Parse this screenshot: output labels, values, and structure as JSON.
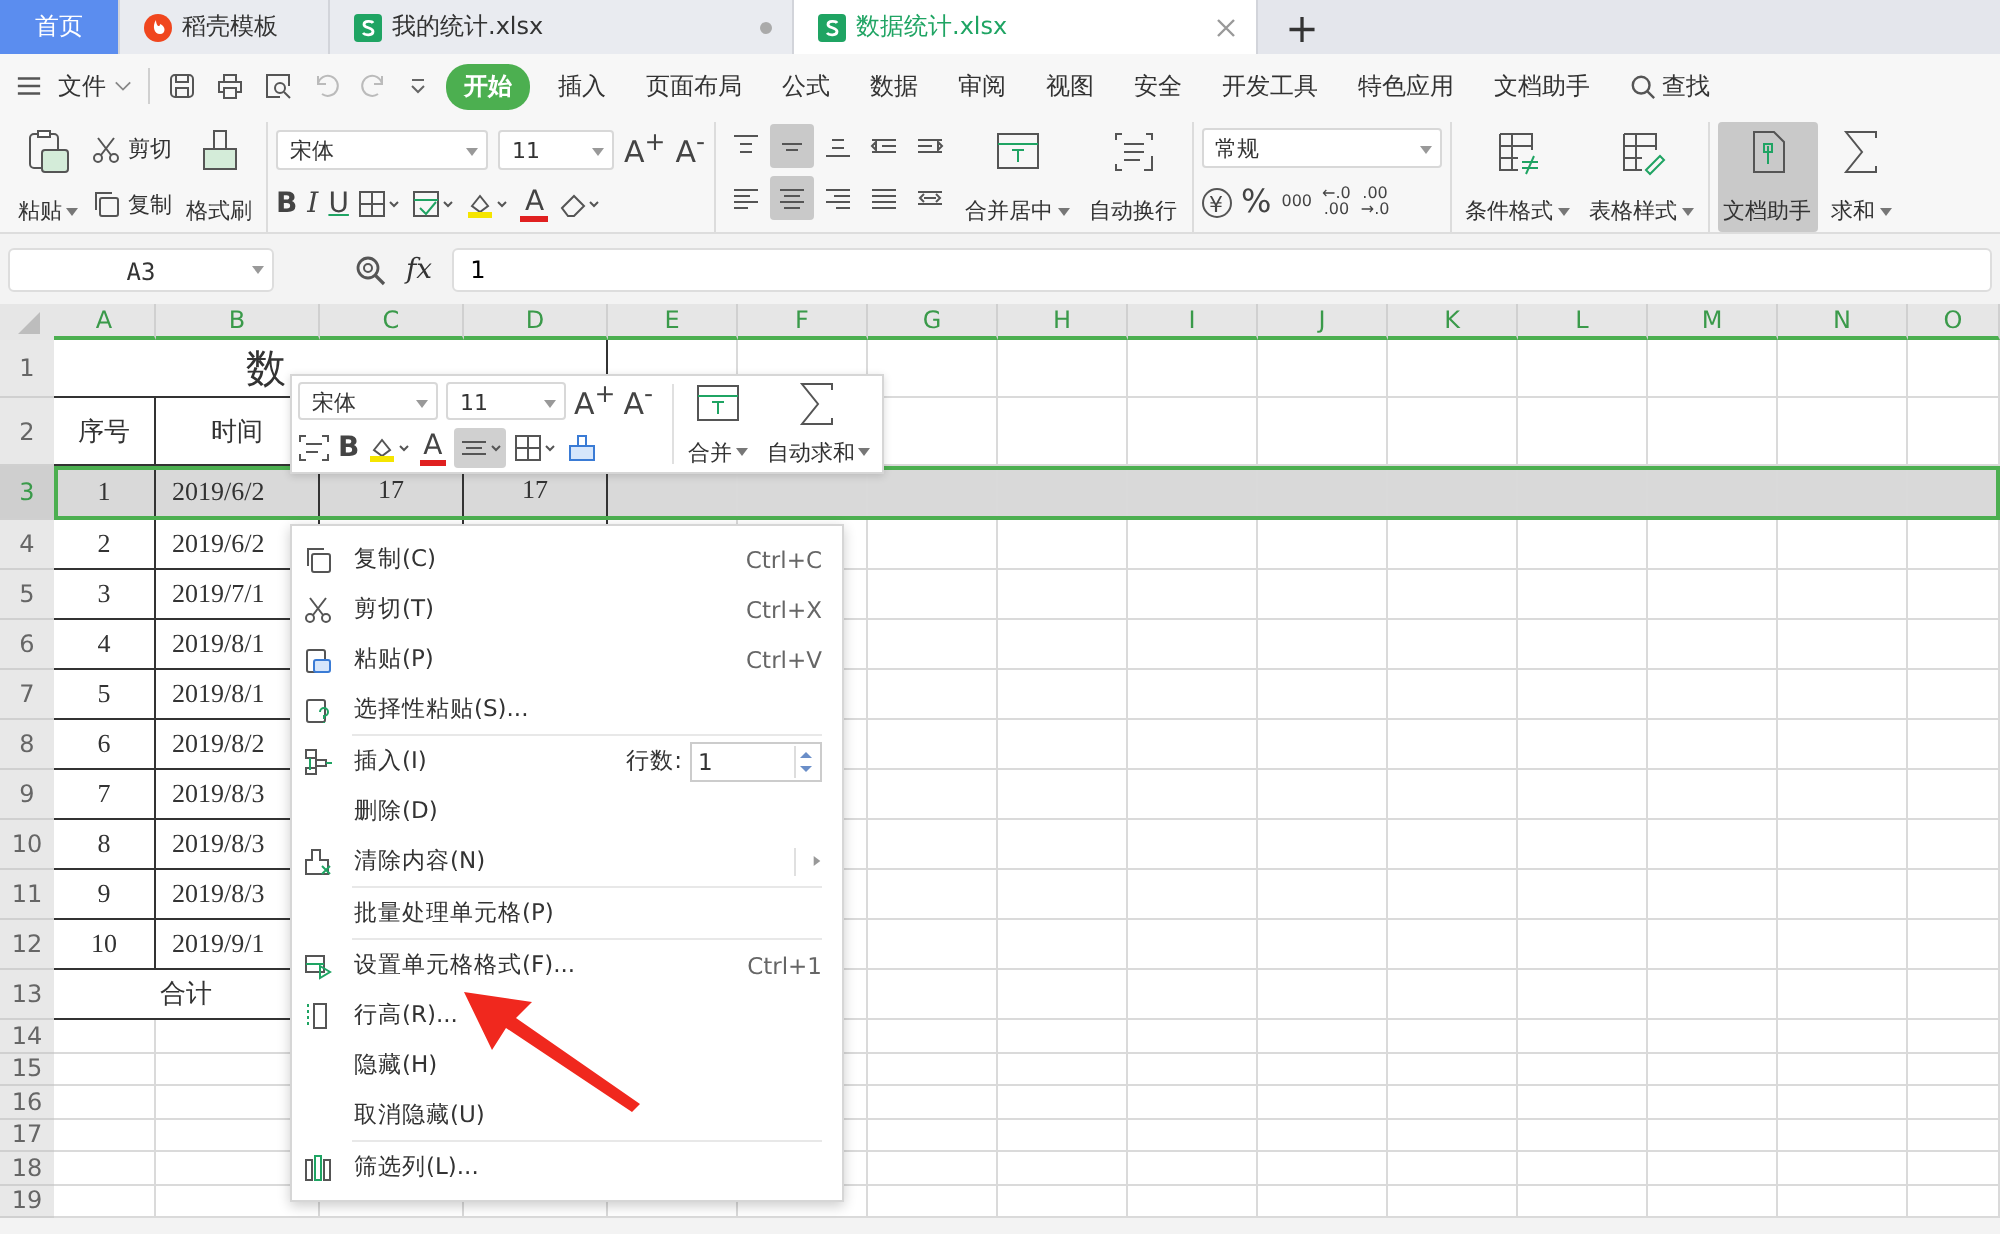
{
  "tabs": [
    {
      "label": "首页",
      "kind": "home",
      "selected": false,
      "modified": false
    },
    {
      "label": "稻壳模板",
      "kind": "docer",
      "selected": false,
      "modified": false
    },
    {
      "label": "我的统计.xlsx",
      "kind": "sheet",
      "selected": false,
      "modified": true
    },
    {
      "label": "数据统计.xlsx",
      "kind": "sheet",
      "selected": true,
      "modified": false
    }
  ],
  "new_tab": "+",
  "menu": {
    "file": "文件",
    "items": [
      {
        "label": "开始",
        "selected": true
      },
      {
        "label": "插入",
        "selected": false
      },
      {
        "label": "页面布局",
        "selected": false
      },
      {
        "label": "公式",
        "selected": false
      },
      {
        "label": "数据",
        "selected": false
      },
      {
        "label": "审阅",
        "selected": false
      },
      {
        "label": "视图",
        "selected": false
      },
      {
        "label": "安全",
        "selected": false
      },
      {
        "label": "开发工具",
        "selected": false
      },
      {
        "label": "特色应用",
        "selected": false
      },
      {
        "label": "文档助手",
        "selected": false
      }
    ],
    "search": "查找"
  },
  "ribbon": {
    "paste": "粘贴",
    "cut": "剪切",
    "copy": "复制",
    "format_painter": "格式刷",
    "font": "宋体",
    "size": "11",
    "grow": "A$^{+}$",
    "shrink": "A$^{-}$",
    "bold": "B",
    "italic": "I",
    "underline": "U",
    "font_color": "A",
    "align_buttons": [
      {
        "selected": false
      },
      {
        "selected": true
      },
      {
        "selected": false
      },
      {
        "selected": false
      },
      {
        "selected": false
      },
      {
        "selected": false
      },
      {
        "selected": true
      },
      {
        "selected": false
      },
      {
        "selected": false
      },
      {
        "selected": false
      }
    ],
    "merge": "合并居中",
    "wrap": "自动换行",
    "number_format": "常规",
    "currency": "¥",
    "percent": "%",
    "thousands": "000",
    "inc_decimal": "←.0\n.00",
    "dec_decimal": ".00\n→.0",
    "cond_format": "条件格式",
    "table_style": "表格样式",
    "assistant": {
      "label": "文档助手",
      "selected": true
    },
    "sum": "求和"
  },
  "formula": {
    "cell": "A3",
    "fx": "fx",
    "value": "1"
  },
  "columns": [
    "A",
    "B",
    "C",
    "D",
    "E",
    "F",
    "G",
    "H",
    "I",
    "J",
    "K",
    "L",
    "M",
    "N",
    "O"
  ],
  "rows": [
    {
      "label": "1",
      "selected": false
    },
    {
      "label": "2",
      "selected": false
    },
    {
      "label": "3",
      "selected": true
    },
    {
      "label": "4",
      "selected": false
    },
    {
      "label": "5",
      "selected": false
    },
    {
      "label": "6",
      "selected": false
    },
    {
      "label": "7",
      "selected": false
    },
    {
      "label": "8",
      "selected": false
    },
    {
      "label": "9",
      "selected": false
    },
    {
      "label": "10",
      "selected": false
    },
    {
      "label": "11",
      "selected": false
    },
    {
      "label": "12",
      "selected": false
    },
    {
      "label": "13",
      "selected": false
    },
    {
      "label": "14",
      "selected": false
    },
    {
      "label": "15",
      "selected": false
    },
    {
      "label": "16",
      "selected": false
    },
    {
      "label": "17",
      "selected": false
    },
    {
      "label": "18",
      "selected": false
    },
    {
      "label": "19",
      "selected": false
    }
  ],
  "sheet": {
    "title": "数",
    "header": [
      "序号",
      "时间"
    ],
    "total": "合计",
    "records": [
      [
        "1",
        "2019/6/2",
        "17",
        "17"
      ],
      [
        "2",
        "2019/6/2"
      ],
      [
        "3",
        "2019/7/1"
      ],
      [
        "4",
        "2019/8/1"
      ],
      [
        "5",
        "2019/8/1"
      ],
      [
        "6",
        "2019/8/2"
      ],
      [
        "7",
        "2019/8/3"
      ],
      [
        "8",
        "2019/8/3"
      ],
      [
        "9",
        "2019/8/3"
      ],
      [
        "10",
        "2019/9/1"
      ]
    ]
  },
  "mini_toolbar": {
    "font": "宋体",
    "size": "11",
    "grow": "A$^{+}$",
    "shrink": "A$^{-}$",
    "bold": "B",
    "font_color": "A",
    "align_selected": true,
    "merge": "合并",
    "autosum": "自动求和"
  },
  "context_menu": [
    {
      "kind": "command",
      "label": "复制(C)",
      "shortcut": "Ctrl+C"
    },
    {
      "kind": "command",
      "label": "剪切(T)",
      "shortcut": "Ctrl+X"
    },
    {
      "kind": "command",
      "label": "粘贴(P)",
      "shortcut": "Ctrl+V"
    },
    {
      "kind": "command",
      "label": "选择性粘贴(S)..."
    },
    {
      "kind": "separator"
    },
    {
      "kind": "count",
      "label": "插入(I)",
      "count_label": "行数:",
      "count_value": "1"
    },
    {
      "kind": "command",
      "label": "删除(D)"
    },
    {
      "kind": "submenu",
      "label": "清除内容(N)"
    },
    {
      "kind": "separator"
    },
    {
      "kind": "command",
      "label": "批量处理单元格(P)"
    },
    {
      "kind": "separator"
    },
    {
      "kind": "command",
      "label": "设置单元格格式(F)...",
      "shortcut": "Ctrl+1"
    },
    {
      "kind": "command",
      "label": "行高(R)..."
    },
    {
      "kind": "command",
      "label": "隐藏(H)"
    },
    {
      "kind": "command",
      "label": "取消隐藏(U)"
    },
    {
      "kind": "separator"
    },
    {
      "kind": "command",
      "label": "筛选列(L)..."
    }
  ]
}
